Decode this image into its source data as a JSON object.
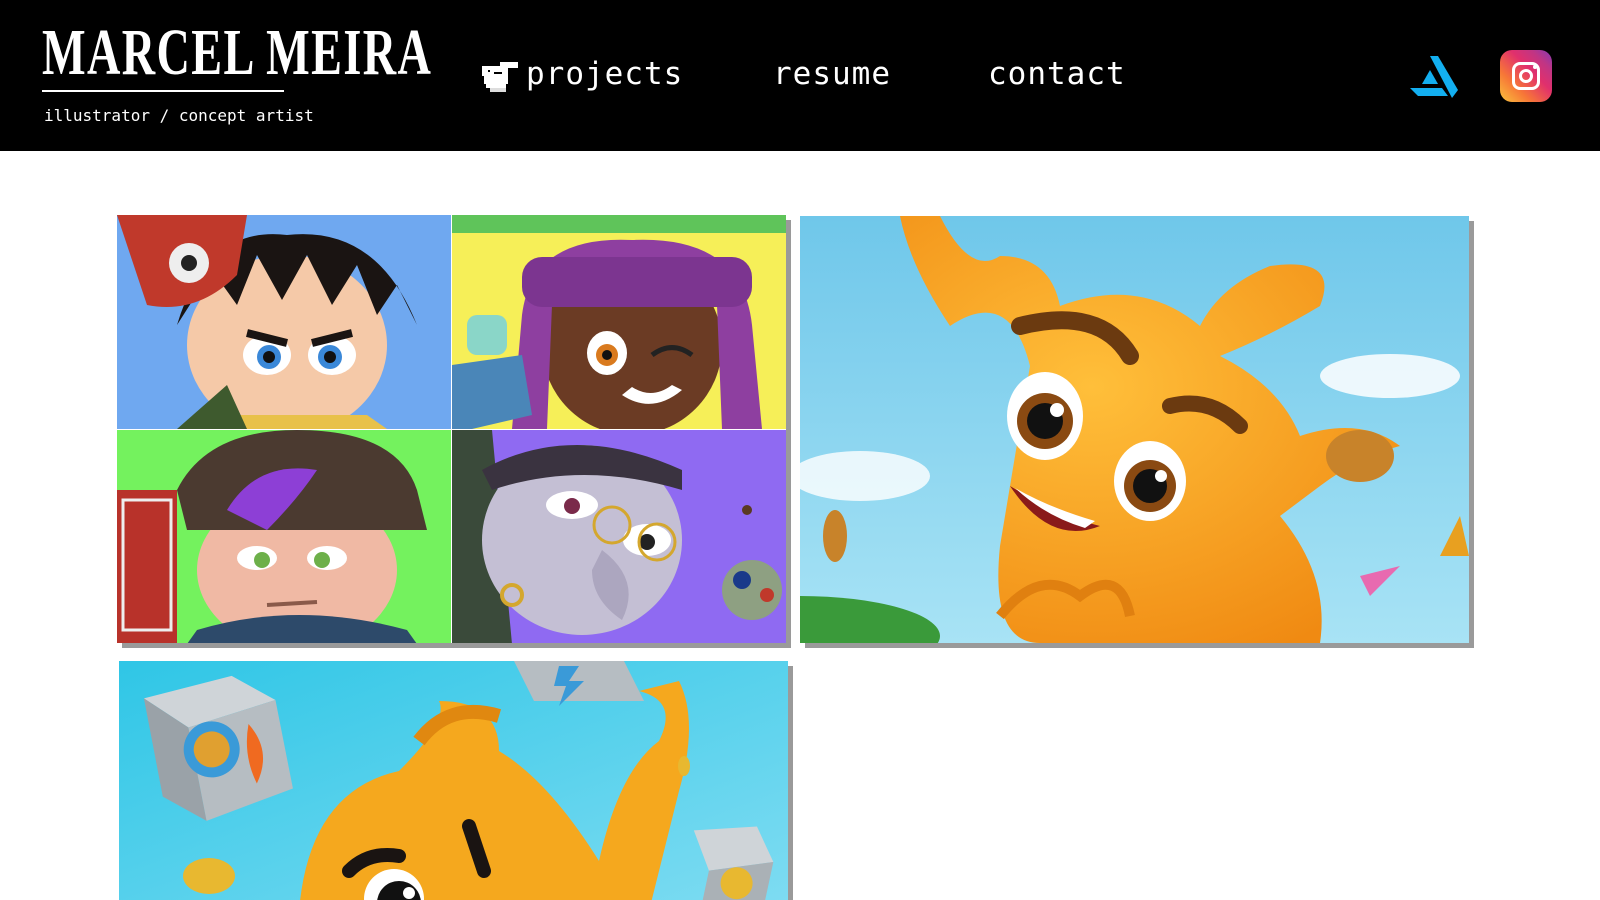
{
  "header": {
    "brand_name": "MARCEL MEIRA",
    "brand_subtitle": "illustrator / concept artist",
    "nav": {
      "projects": "projects",
      "resume": "resume",
      "contact": "contact"
    },
    "social": {
      "artstation_icon": "artstation-icon",
      "instagram_icon": "instagram-icon"
    }
  },
  "gallery": {
    "tiles": [
      {
        "name": "character-portraits-grid"
      },
      {
        "name": "orange-mascot-waving"
      },
      {
        "name": "orange-mascot-with-dice"
      }
    ]
  },
  "colors": {
    "header_bg": "#000000",
    "artstation_blue": "#13aff0",
    "page_bg": "#ffffff",
    "tile_shadow": "#9a9a9a"
  }
}
